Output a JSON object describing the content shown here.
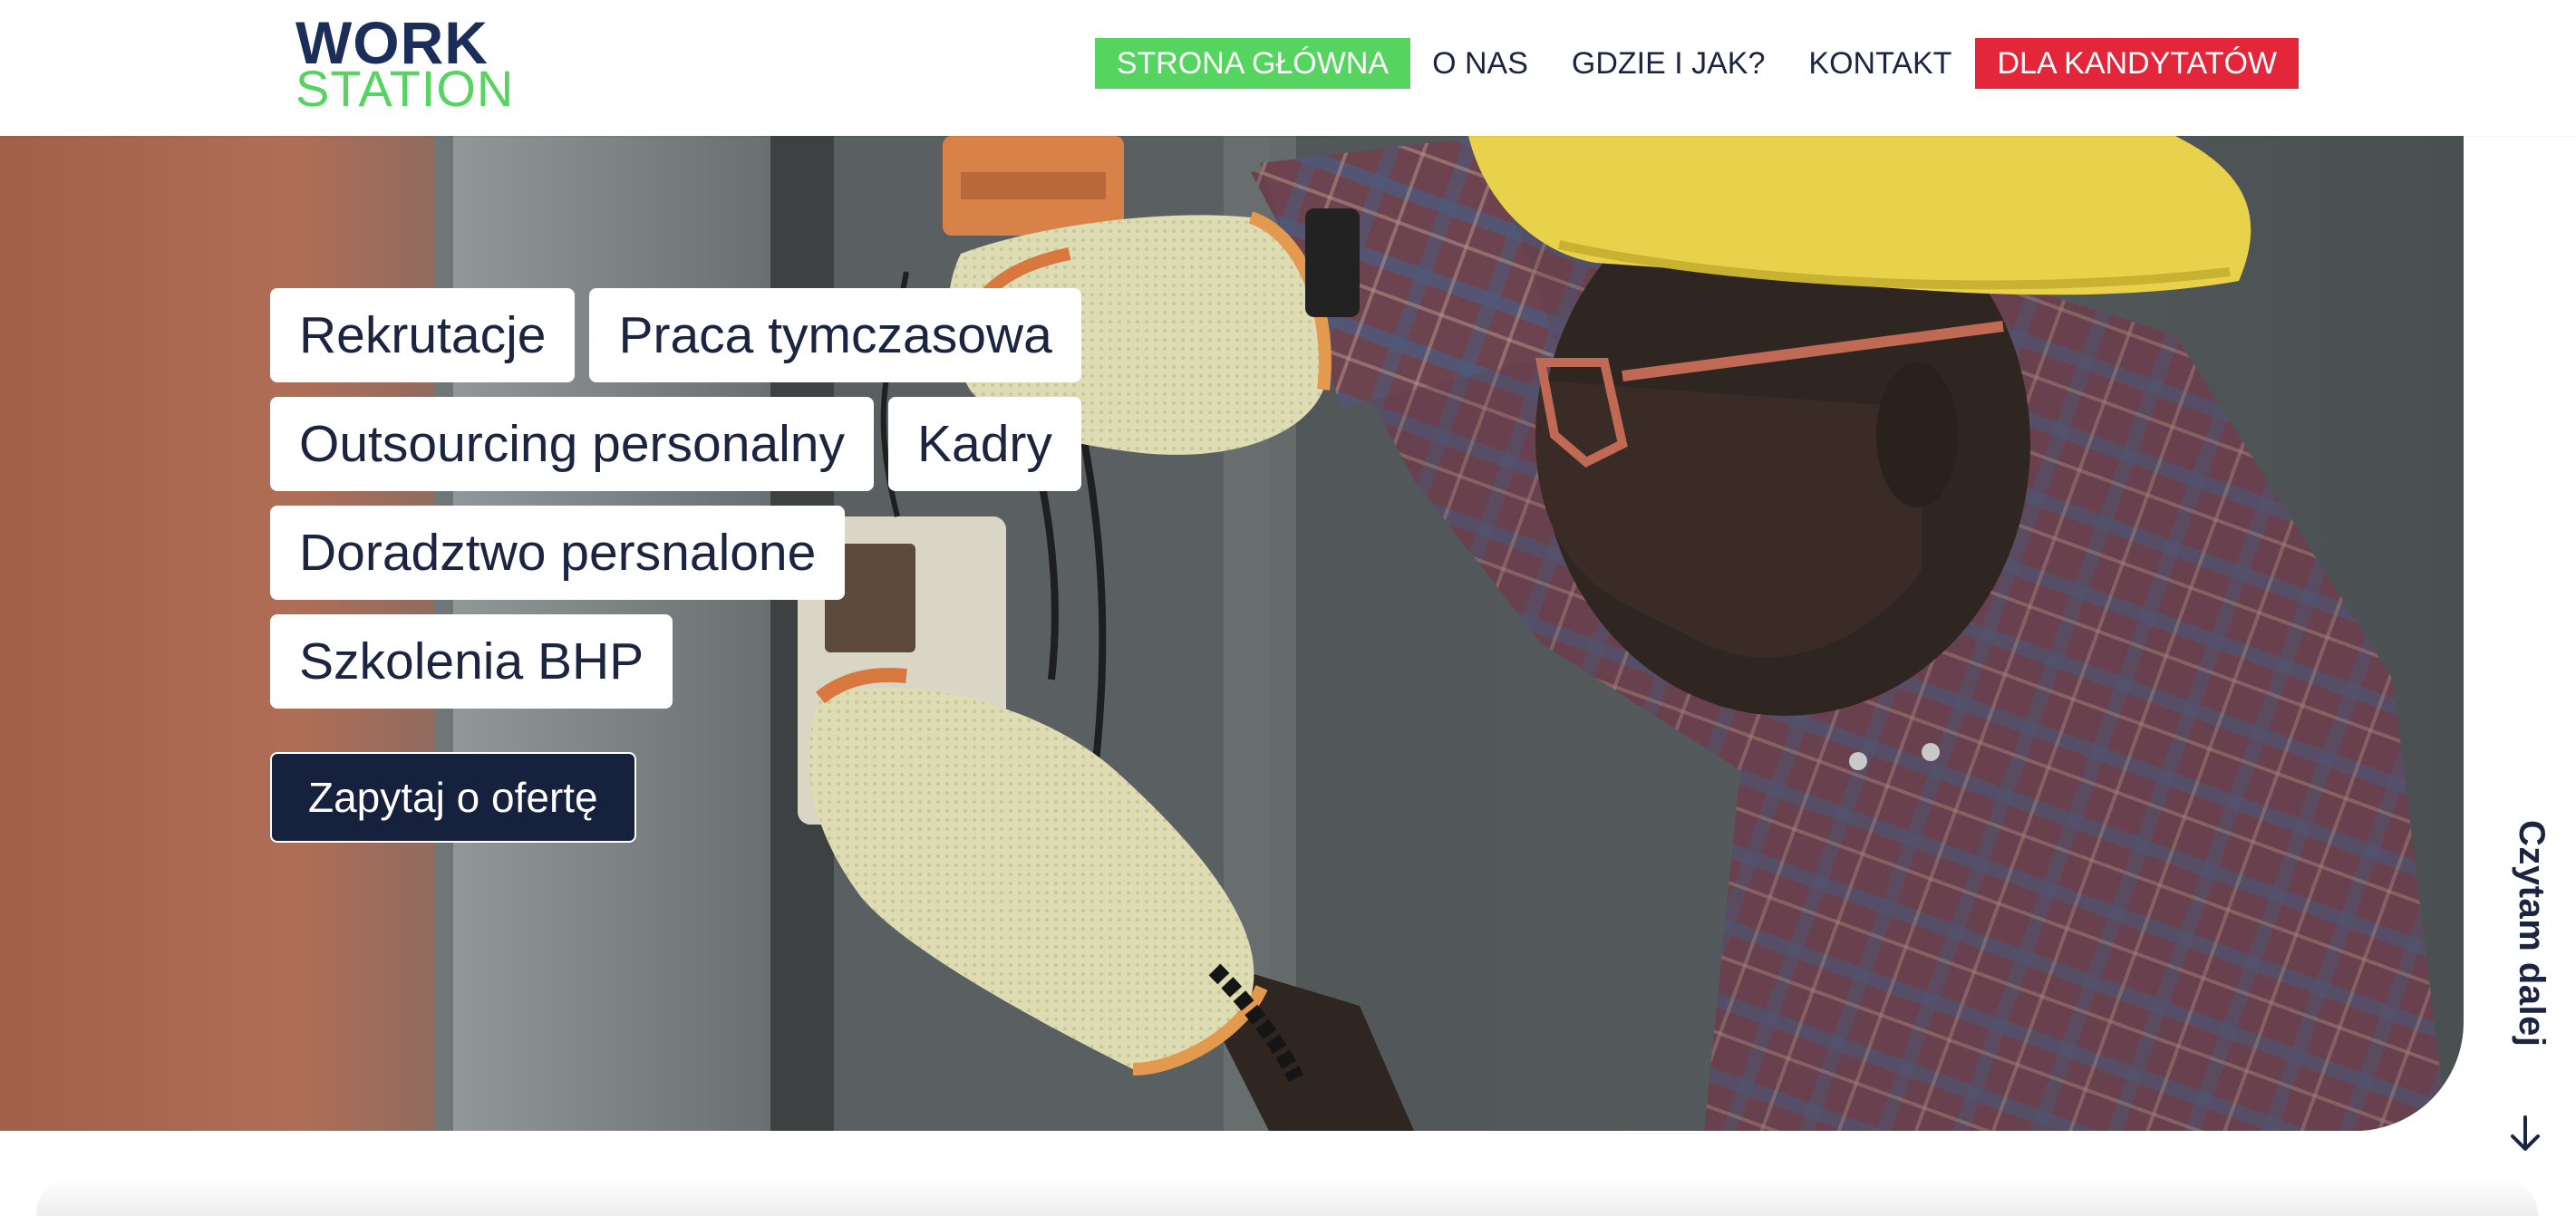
{
  "logo": {
    "line1": "WORK",
    "line2": "STATION"
  },
  "nav": {
    "items": [
      {
        "label": "STRONA GŁÓWNA"
      },
      {
        "label": "O NAS"
      },
      {
        "label": "GDZIE I JAK?"
      },
      {
        "label": "KONTAKT"
      },
      {
        "label": "DLA KANDYTATÓW"
      }
    ]
  },
  "hero": {
    "tags": [
      "Rekrutacje",
      "Praca tymczasowa",
      "Outsourcing personalny",
      "Kadry",
      "Doradztwo persnalone",
      "Szkolenia BHP"
    ],
    "cta_label": "Zapytaj o ofertę"
  },
  "readmore": {
    "label": "Czytam dalej"
  },
  "colors": {
    "brand_navy": "#1b2d59",
    "brand_green": "#55d45f",
    "candidates_red": "#e3263a",
    "cta_dark": "#16213d"
  }
}
